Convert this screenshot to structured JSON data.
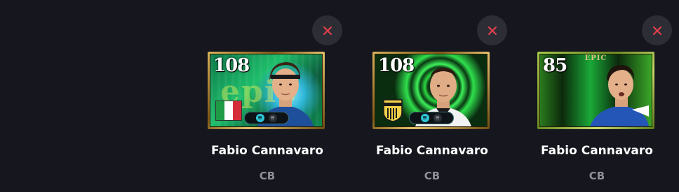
{
  "colors": {
    "background": "#15161e",
    "remove_button_bg": "#2d2d36",
    "remove_icon": "#e0404a",
    "name_text": "#ffffff",
    "position_text": "#8e8f96",
    "card_frame_gold": "#c9a24a"
  },
  "players": [
    {
      "name": "Fabio Cannavaro",
      "position": "CB",
      "rating": "108",
      "card_background_text": "epic",
      "badge": "italy-flag",
      "skill_icons": [
        "active-skill-icon",
        "inactive-skill-icon"
      ]
    },
    {
      "name": "Fabio Cannavaro",
      "position": "CB",
      "rating": "108",
      "badge": "club-crest",
      "skill_icons": [
        "active-skill-icon",
        "inactive-skill-icon"
      ]
    },
    {
      "name": "Fabio Cannavaro",
      "position": "CB",
      "rating": "85",
      "card_banner": "EPIC",
      "badge": "none",
      "skill_icons": []
    }
  ],
  "remove_icon": "close-icon"
}
